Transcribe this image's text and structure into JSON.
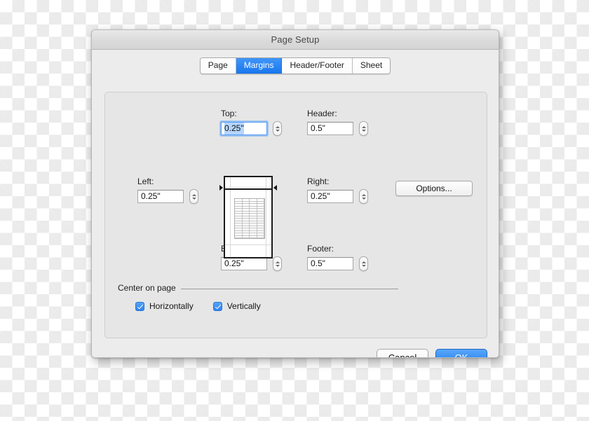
{
  "window": {
    "title": "Page Setup"
  },
  "tabs": [
    {
      "label": "Page",
      "active": false
    },
    {
      "label": "Margins",
      "active": true
    },
    {
      "label": "Header/Footer",
      "active": false
    },
    {
      "label": "Sheet",
      "active": false
    }
  ],
  "fields": {
    "top": {
      "label": "Top:",
      "value": "0.25\"",
      "focused": true
    },
    "header": {
      "label": "Header:",
      "value": "0.5\"",
      "focused": false
    },
    "left": {
      "label": "Left:",
      "value": "0.25\"",
      "focused": false
    },
    "right": {
      "label": "Right:",
      "value": "0.25\"",
      "focused": false
    },
    "bottom": {
      "label": "Bottom:",
      "value": "0.25\"",
      "focused": false
    },
    "footer": {
      "label": "Footer:",
      "value": "0.5\"",
      "focused": false
    }
  },
  "options_button": {
    "label": "Options..."
  },
  "center_on_page": {
    "section_label": "Center on page",
    "horizontally": {
      "label": "Horizontally",
      "checked": true
    },
    "vertically": {
      "label": "Vertically",
      "checked": true
    }
  },
  "buttons": {
    "cancel": "Cancel",
    "ok": "OK"
  },
  "preview": {
    "table_columns": 4,
    "table_rows": 16
  },
  "colors": {
    "accent_blue": "#2f83ef",
    "tab_active_blue": "#1877ef",
    "ok_button_blue": "#2a7ce9",
    "selection_blue": "#b4d5fd",
    "dialog_bg": "#ececec",
    "panel_bg": "#e6e6e6"
  }
}
